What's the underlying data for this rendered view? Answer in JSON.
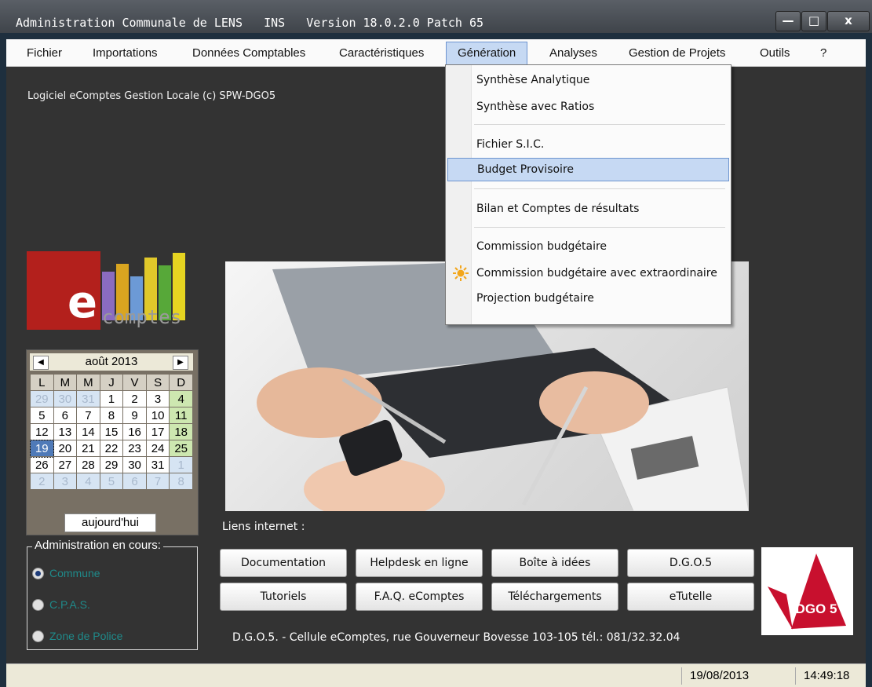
{
  "window": {
    "title": "Administration Communale de LENS   INS   Version 18.0.2.0 Patch 65",
    "min_label": "—",
    "max_label": "□",
    "close_label": "x"
  },
  "menu": {
    "items": [
      "Fichier",
      "Importations",
      "Données Comptables",
      "Caractéristiques",
      "Génération",
      "Analyses",
      "Gestion de Projets",
      "Outils",
      "?"
    ],
    "active": "Génération"
  },
  "dropdown": {
    "items": [
      "Synthèse Analytique",
      "Synthèse avec Ratios",
      "Fichier S.I.C.",
      "Budget Provisoire",
      "Bilan et Comptes de résultats",
      "Commission budgétaire",
      "Commission budgétaire avec extraordinaire",
      "Projection budgétaire"
    ],
    "highlighted": "Budget Provisoire"
  },
  "main": {
    "copyright": "Logiciel eComptes Gestion Locale (c) SPW-DGO5"
  },
  "logo": {
    "letter": "e",
    "word": "comptes"
  },
  "calendar": {
    "month": "août 2013",
    "day_headers": [
      "L",
      "M",
      "M",
      "J",
      "V",
      "S",
      "D"
    ],
    "weeks": [
      [
        "29",
        "30",
        "31",
        "1",
        "2",
        "3",
        "4"
      ],
      [
        "5",
        "6",
        "7",
        "8",
        "9",
        "10",
        "11"
      ],
      [
        "12",
        "13",
        "14",
        "15",
        "16",
        "17",
        "18"
      ],
      [
        "19",
        "20",
        "21",
        "22",
        "23",
        "24",
        "25"
      ],
      [
        "26",
        "27",
        "28",
        "29",
        "30",
        "31",
        "1"
      ],
      [
        "2",
        "3",
        "4",
        "5",
        "6",
        "7",
        "8"
      ]
    ],
    "today_label": "aujourd'hui",
    "selected_day": "19"
  },
  "admin": {
    "legend": "Administration en cours:",
    "options": [
      "Commune",
      "C.P.A.S.",
      "Zone de Police"
    ],
    "selected": "Commune"
  },
  "links": {
    "heading": "Liens internet :",
    "row1": [
      "Documentation",
      "Helpdesk en ligne",
      "Boîte à idées",
      "D.G.O.5"
    ],
    "row2": [
      "Tutoriels",
      "F.A.Q. eComptes",
      "Téléchargements",
      "eTutelle"
    ]
  },
  "footer": {
    "text": "D.G.O.5. - Cellule eComptes, rue Gouverneur Bovesse 103-105 tél.: 081/32.32.04"
  },
  "dgo_logo": {
    "text": "DGO 5"
  },
  "statusbar": {
    "date": "19/08/2013",
    "time": "14:49:18"
  },
  "colors": {
    "background": "#333333",
    "menu_highlight": "#c6d9f3",
    "logo_red": "#b3201c"
  }
}
